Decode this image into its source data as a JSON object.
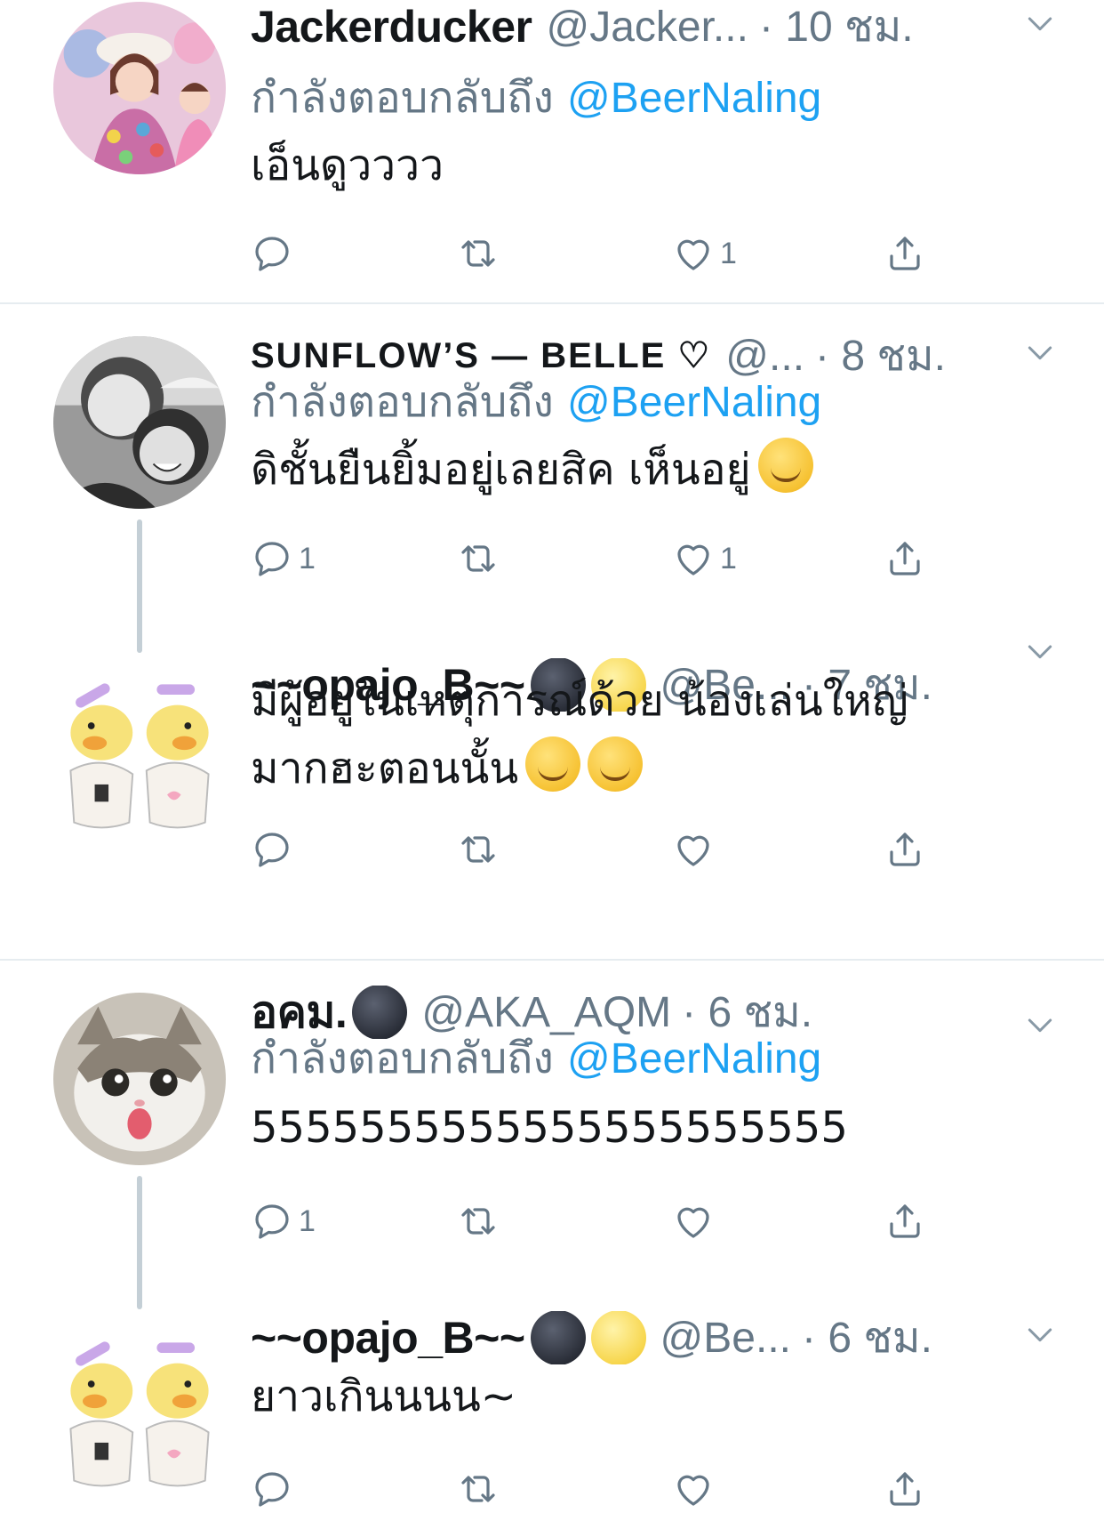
{
  "replying_to_label": "กำลังตอบกลับถึง",
  "tweets": [
    {
      "name": "Jackerducker",
      "handle": "@Jacker...",
      "time": "· 10 ชม.",
      "reply_mention": "@BeerNaling",
      "text_line1": "เอ็นดูวววว",
      "text_line2": "",
      "reply_count": "",
      "retweet_count": "",
      "like_count": "1"
    },
    {
      "name": "SUNFLOW’S — BELLE ♡",
      "handle": "@...",
      "time": "· 8 ชม.",
      "reply_mention": "@BeerNaling",
      "text_line1": "ดิชั้นยืนยิ้มอยู่เลยสิค เห็นอยู่",
      "text_line2": "",
      "reply_count": "1",
      "retweet_count": "",
      "like_count": "1"
    },
    {
      "name": "~~opajo_B~~",
      "handle": "@Be...",
      "time": "· 7 ชม.",
      "reply_mention": "",
      "text_line1": "มีผู้อยู่ในเหตุการณ์ด้วย น้องเล่นใหญ่",
      "text_line2": "มากฮะตอนนั้น",
      "reply_count": "",
      "retweet_count": "",
      "like_count": ""
    },
    {
      "name": "อคม.",
      "handle": "@AKA_AQM",
      "time": "· 6 ชม.",
      "reply_mention": "@BeerNaling",
      "text_line1": "5555555555555555555555",
      "text_line2": "",
      "reply_count": "1",
      "retweet_count": "",
      "like_count": ""
    },
    {
      "name": "~~opajo_B~~",
      "handle": "@Be...",
      "time": "· 6 ชม.",
      "reply_mention": "",
      "text_line1": "ยาวเกินนนน~",
      "text_line2": "",
      "reply_count": "",
      "retweet_count": "",
      "like_count": ""
    }
  ],
  "colors": {
    "accent": "#1da1f2",
    "muted": "#657786",
    "text": "#14171a",
    "divider": "#e6ecf0",
    "thread_line": "#c4cfd6"
  },
  "icons": [
    "reply-icon",
    "retweet-icon",
    "like-icon",
    "share-icon",
    "caret-down-icon"
  ]
}
